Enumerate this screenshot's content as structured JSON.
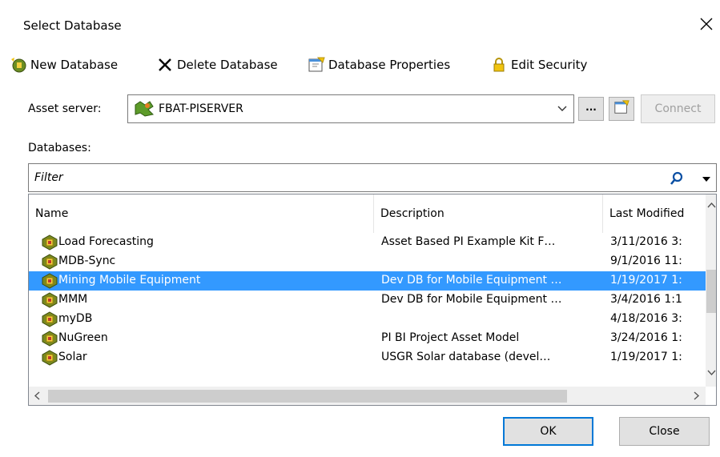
{
  "window": {
    "title": "Select Database"
  },
  "toolbar": {
    "new_database": "New Database",
    "delete_database": "Delete Database",
    "database_properties": "Database Properties",
    "edit_security": "Edit Security"
  },
  "asset_server": {
    "label": "Asset server:",
    "value": "FBAT-PISERVER",
    "browse_label": "...",
    "connect_label": "Connect"
  },
  "databases": {
    "label": "Databases:",
    "filter_placeholder": "Filter",
    "columns": [
      "Name",
      "Description",
      "Last Modified"
    ],
    "rows": [
      {
        "name": "Load Forecasting",
        "description": "Asset Based PI Example Kit F…",
        "last_modified": "3/11/2016 3:",
        "selected": false
      },
      {
        "name": "MDB-Sync",
        "description": "",
        "last_modified": "9/1/2016 11:",
        "selected": false
      },
      {
        "name": "Mining Mobile Equipment",
        "description": "Dev DB for Mobile Equipment …",
        "last_modified": "1/19/2017 1:",
        "selected": true
      },
      {
        "name": "MMM",
        "description": "Dev DB for Mobile Equipment …",
        "last_modified": "3/4/2016 1:1",
        "selected": false
      },
      {
        "name": "myDB",
        "description": "",
        "last_modified": "4/18/2016 3:",
        "selected": false
      },
      {
        "name": "NuGreen",
        "description": "PI BI Project Asset Model",
        "last_modified": "3/24/2016 1:",
        "selected": false
      },
      {
        "name": "Solar",
        "description": "USGR Solar database (devel…",
        "last_modified": "1/19/2017 1:",
        "selected": false
      }
    ]
  },
  "footer": {
    "ok_label": "OK",
    "close_label": "Close"
  },
  "colors": {
    "selection": "#3399ff",
    "accent": "#0078d7"
  }
}
